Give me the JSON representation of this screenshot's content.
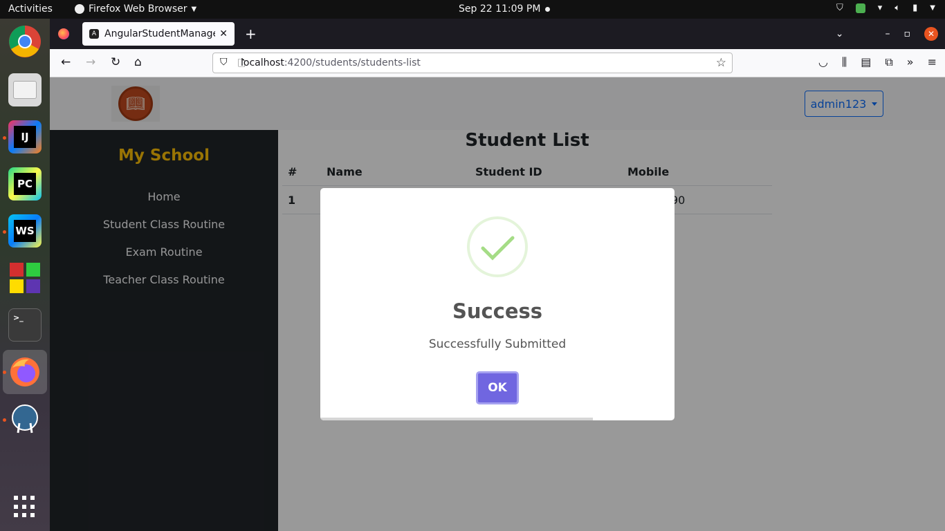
{
  "topbar": {
    "activities": "Activities",
    "app_name": "Firefox Web Browser",
    "clock": "Sep 22  11:09 PM"
  },
  "dock": {
    "apps": [
      {
        "name": "chrome-icon"
      },
      {
        "name": "files-icon"
      },
      {
        "name": "intellij-icon",
        "label": "IJ"
      },
      {
        "name": "pycharm-icon",
        "label": "PC"
      },
      {
        "name": "webstorm-icon",
        "label": "WS"
      },
      {
        "name": "grid-app-icon"
      },
      {
        "name": "terminal-icon",
        "label": ">_"
      },
      {
        "name": "firefox-icon"
      },
      {
        "name": "pgadmin-icon"
      }
    ]
  },
  "browser": {
    "tab_title": "AngularStudentManagement",
    "url_host": "localhost",
    "url_rest": ":4200/students/students-list"
  },
  "page": {
    "user_menu": "admin123",
    "brand": "My School",
    "sidebar_items": [
      "Home",
      "Student Class Routine",
      "Exam Routine",
      "Teacher Class Routine"
    ],
    "title": "Student List",
    "table": {
      "headers": [
        "#",
        "Name",
        "Student ID",
        "Mobile"
      ],
      "rows": [
        {
          "num": "1",
          "mobile_visible": "90"
        }
      ]
    }
  },
  "modal": {
    "title": "Success",
    "message": "Successfully Submitted",
    "ok_label": "OK",
    "timer_progress": 0.77,
    "check_color": "#a5dc86"
  }
}
